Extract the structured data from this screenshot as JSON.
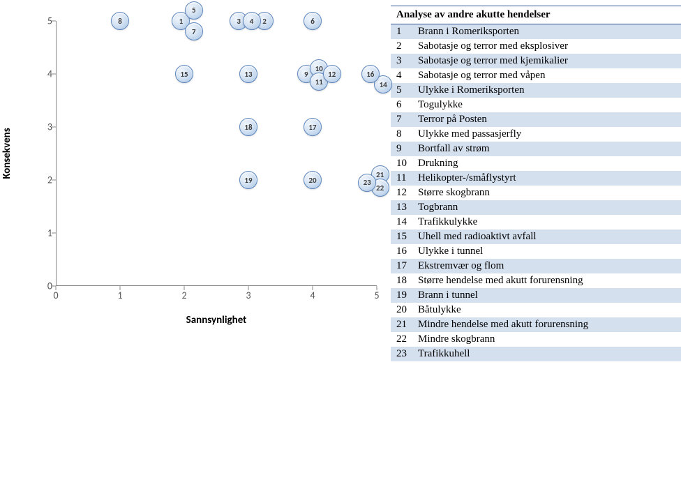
{
  "chart_data": {
    "type": "scatter",
    "xlabel": "Sannsynlighet",
    "ylabel": "Konsekvens",
    "xlim": [
      0,
      5
    ],
    "ylim": [
      0,
      5
    ],
    "xticks": [
      0,
      1,
      2,
      3,
      4,
      5
    ],
    "yticks": [
      0,
      1,
      2,
      3,
      4,
      5
    ],
    "points": [
      {
        "id": 1,
        "x": 1.95,
        "y": 5.0,
        "label": "1"
      },
      {
        "id": 2,
        "x": 3.25,
        "y": 5.0,
        "label": "2"
      },
      {
        "id": 3,
        "x": 2.85,
        "y": 5.0,
        "label": "3"
      },
      {
        "id": 4,
        "x": 3.05,
        "y": 5.0,
        "label": "4"
      },
      {
        "id": 5,
        "x": 2.15,
        "y": 5.2,
        "label": "5"
      },
      {
        "id": 6,
        "x": 4.0,
        "y": 5.0,
        "label": "6"
      },
      {
        "id": 7,
        "x": 2.15,
        "y": 4.8,
        "label": "7"
      },
      {
        "id": 8,
        "x": 1.0,
        "y": 5.0,
        "label": "8"
      },
      {
        "id": 9,
        "x": 3.9,
        "y": 4.0,
        "label": "9"
      },
      {
        "id": 10,
        "x": 4.1,
        "y": 4.1,
        "label": "10"
      },
      {
        "id": 11,
        "x": 4.1,
        "y": 3.85,
        "label": "11"
      },
      {
        "id": 12,
        "x": 4.3,
        "y": 4.0,
        "label": "12"
      },
      {
        "id": 13,
        "x": 3.0,
        "y": 4.0,
        "label": "13"
      },
      {
        "id": 14,
        "x": 5.1,
        "y": 3.8,
        "label": "14"
      },
      {
        "id": 15,
        "x": 2.0,
        "y": 4.0,
        "label": "15"
      },
      {
        "id": 16,
        "x": 4.9,
        "y": 4.0,
        "label": "16"
      },
      {
        "id": 17,
        "x": 4.0,
        "y": 3.0,
        "label": "17"
      },
      {
        "id": 18,
        "x": 3.0,
        "y": 3.0,
        "label": "18"
      },
      {
        "id": 19,
        "x": 3.0,
        "y": 2.0,
        "label": "19"
      },
      {
        "id": 20,
        "x": 4.0,
        "y": 2.0,
        "label": "20"
      },
      {
        "id": 21,
        "x": 5.05,
        "y": 2.1,
        "label": "21"
      },
      {
        "id": 22,
        "x": 5.05,
        "y": 1.85,
        "label": "22"
      },
      {
        "id": 23,
        "x": 4.85,
        "y": 1.95,
        "label": "23"
      }
    ]
  },
  "table": {
    "header": "Analyse  av andre  akutte  hendelser",
    "rows": [
      {
        "num": "1",
        "text": "Brann i Romeriksporten"
      },
      {
        "num": "2",
        "text": "Sabotasje og terror med eksplosiver"
      },
      {
        "num": "3",
        "text": "Sabotasje og terror med kjemikalier"
      },
      {
        "num": "4",
        "text": "Sabotasje og terror med våpen"
      },
      {
        "num": "5",
        "text": "Ulykke i Romeriksporten"
      },
      {
        "num": "6",
        "text": "Togulykke"
      },
      {
        "num": "7",
        "text": "Terror på Posten"
      },
      {
        "num": "8",
        "text": "Ulykke med passasjerfly"
      },
      {
        "num": "9",
        "text": "Bortfall av strøm"
      },
      {
        "num": "10",
        "text": "Drukning"
      },
      {
        "num": "11",
        "text": "Helikopter-/småflystyrt"
      },
      {
        "num": "12",
        "text": "Større skogbrann"
      },
      {
        "num": "13",
        "text": "Togbrann"
      },
      {
        "num": "14",
        "text": "Trafikkulykke"
      },
      {
        "num": "15",
        "text": "Uhell med radioaktivt avfall"
      },
      {
        "num": "16",
        "text": "Ulykke i tunnel"
      },
      {
        "num": "17",
        "text": "Ekstremvær og flom"
      },
      {
        "num": "18",
        "text": "Større hendelse med akutt forurensning"
      },
      {
        "num": "19",
        "text": "Brann i tunnel"
      },
      {
        "num": "20",
        "text": "Båtulykke"
      },
      {
        "num": "21",
        "text": "Mindre hendelse med akutt forurensning"
      },
      {
        "num": "22",
        "text": "Mindre skogbrann"
      },
      {
        "num": "23",
        "text": "Trafikkuhell"
      }
    ]
  }
}
